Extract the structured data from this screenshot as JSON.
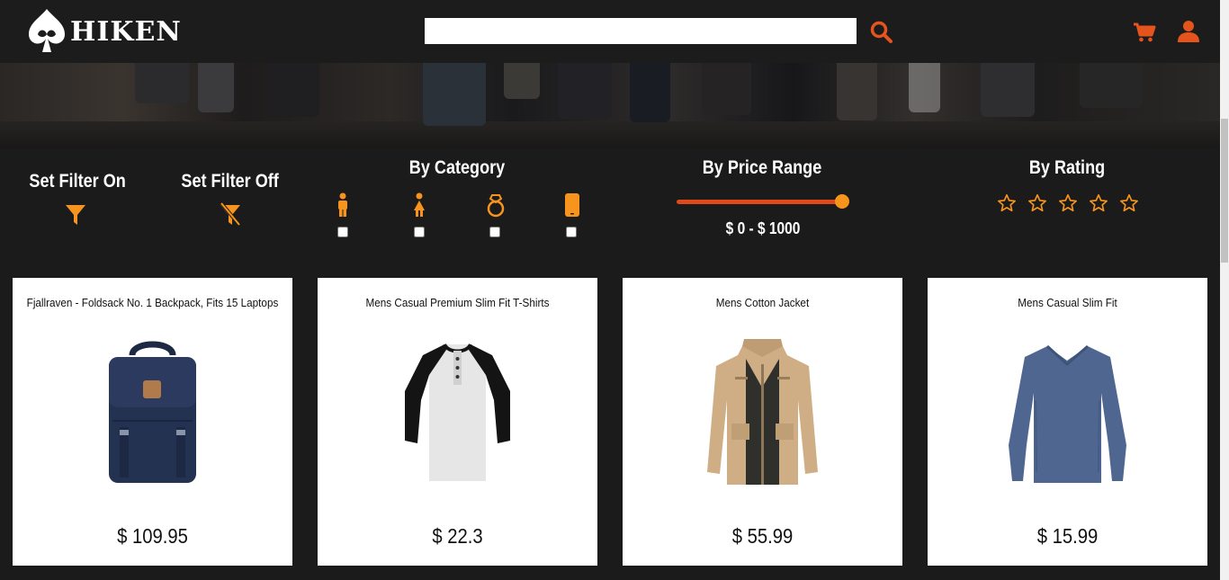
{
  "brand": {
    "name": "HIKEN",
    "accent": "#e4541c"
  },
  "search": {
    "placeholder": "",
    "value": ""
  },
  "filters": {
    "set_on_label": "Set Filter On",
    "set_off_label": "Set Filter Off",
    "category_label": "By Category",
    "categories": [
      {
        "icon": "man-icon",
        "checked": false
      },
      {
        "icon": "woman-icon",
        "checked": false
      },
      {
        "icon": "ring-icon",
        "checked": false
      },
      {
        "icon": "phone-icon",
        "checked": false
      }
    ],
    "price_label": "By Price Range",
    "price_range_text": "$ 0 - $ 1000",
    "price_min": 0,
    "price_max": 1000,
    "rating_label": "By Rating",
    "rating_value": 0,
    "rating_max": 5
  },
  "products": [
    {
      "title": "Fjallraven - Foldsack No. 1 Backpack, Fits 15 Laptops",
      "price": "$ 109.95",
      "image": "backpack"
    },
    {
      "title": "Mens Casual Premium Slim Fit T-Shirts",
      "price": "$ 22.3",
      "image": "raglan-tshirt"
    },
    {
      "title": "Mens Cotton Jacket",
      "price": "$ 55.99",
      "image": "cotton-jacket"
    },
    {
      "title": "Mens Casual Slim Fit",
      "price": "$ 15.99",
      "image": "longsleeve-shirt"
    }
  ]
}
